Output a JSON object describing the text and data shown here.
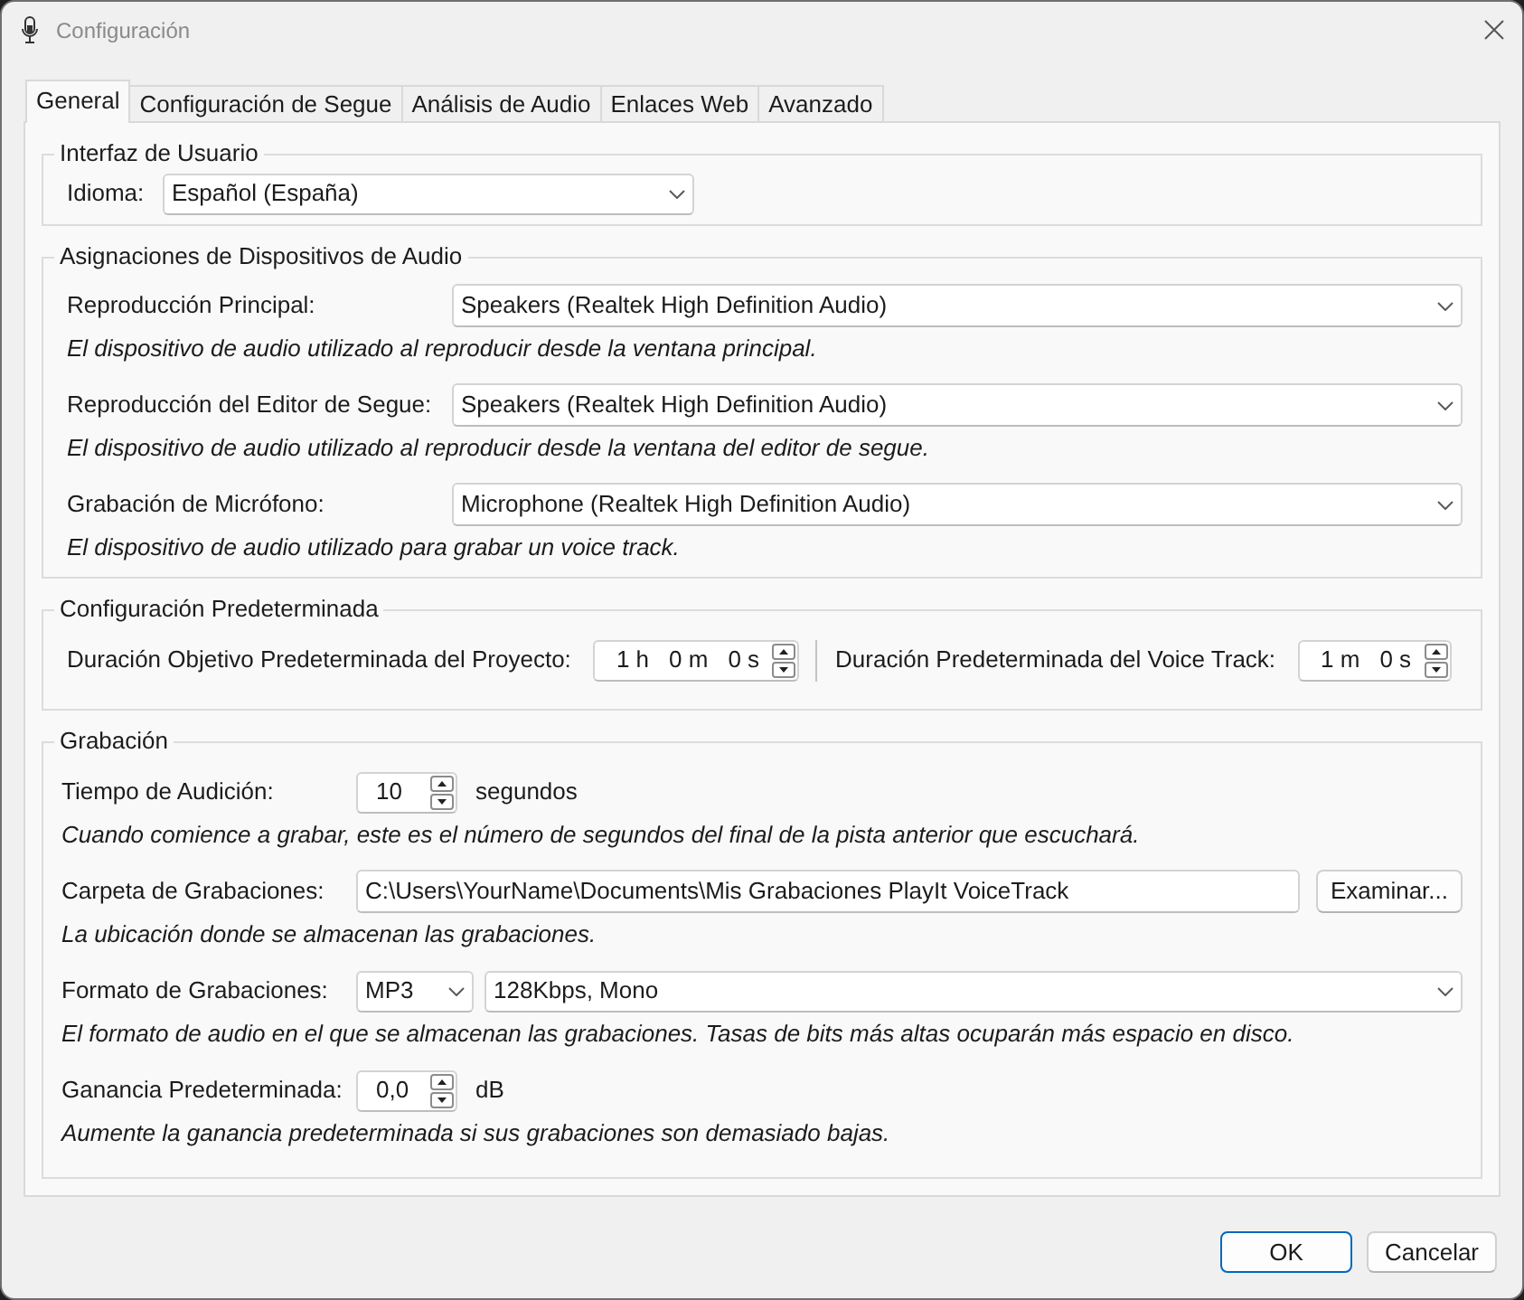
{
  "window": {
    "title": "Configuración"
  },
  "tabs": [
    {
      "label": "General",
      "selected": true
    },
    {
      "label": "Configuración de Segue",
      "selected": false
    },
    {
      "label": "Análisis de Audio",
      "selected": false
    },
    {
      "label": "Enlaces Web",
      "selected": false
    },
    {
      "label": "Avanzado",
      "selected": false
    }
  ],
  "groups": [
    {
      "title": "Interfaz de Usuario",
      "rows": [
        {
          "kind": "dropdown",
          "label": "Idioma:",
          "value": "Español (España)"
        }
      ]
    },
    {
      "title": "Asignaciones de Dispositivos de Audio",
      "rows": [
        {
          "kind": "dropdown",
          "label": "Reproducción Principal:",
          "value": "Speakers (Realtek High Definition Audio)",
          "help": "El dispositivo de audio utilizado al reproducir desde la ventana principal."
        },
        {
          "kind": "dropdown",
          "label": "Reproducción del Editor de Segue:",
          "value": "Speakers (Realtek High Definition Audio)",
          "help": "El dispositivo de audio utilizado al reproducir desde la ventana del editor de segue."
        },
        {
          "kind": "dropdown",
          "label": "Grabación de Micrófono:",
          "value": "Microphone (Realtek High Definition Audio)",
          "help": "El dispositivo de audio utilizado para grabar un voice track."
        }
      ]
    },
    {
      "title": "Configuración Predeterminada",
      "rows": [
        {
          "kind": "durations",
          "fields": [
            {
              "label": "Duración Objetivo Predeterminada del Proyecto:",
              "parts": [
                "1 h",
                "0 m",
                "0 s"
              ]
            },
            {
              "label": "Duración Predeterminada del Voice Track:",
              "parts": [
                "1 m",
                "0 s"
              ]
            }
          ]
        }
      ]
    },
    {
      "title": "Grabación",
      "rows": [
        {
          "kind": "spin",
          "label": "Tiempo de Audición:",
          "value": "10",
          "unit": "segundos",
          "help": "Cuando comience a grabar, este es el número de segundos del final de la pista anterior que escuchará."
        },
        {
          "kind": "path",
          "label": "Carpeta de Grabaciones:",
          "value": "C:\\Users\\YourName\\Documents\\Mis Grabaciones PlayIt VoiceTrack",
          "button": "Examinar...",
          "help": "La ubicación donde se almacenan las grabaciones."
        },
        {
          "kind": "format",
          "label": "Formato de Grabaciones:",
          "values": [
            "MP3",
            "128Kbps, Mono"
          ],
          "help": "El formato de audio en el que se almacenan las grabaciones. Tasas de bits más altas ocuparán más espacio en disco."
        },
        {
          "kind": "spin",
          "label": "Ganancia Predeterminada:",
          "value": "0,0",
          "unit": "dB",
          "help": "Aumente la ganancia predeterminada si sus grabaciones son demasiado bajas."
        }
      ]
    }
  ],
  "buttons": [
    {
      "label": "OK",
      "default": true
    },
    {
      "label": "Cancelar",
      "default": false
    }
  ]
}
